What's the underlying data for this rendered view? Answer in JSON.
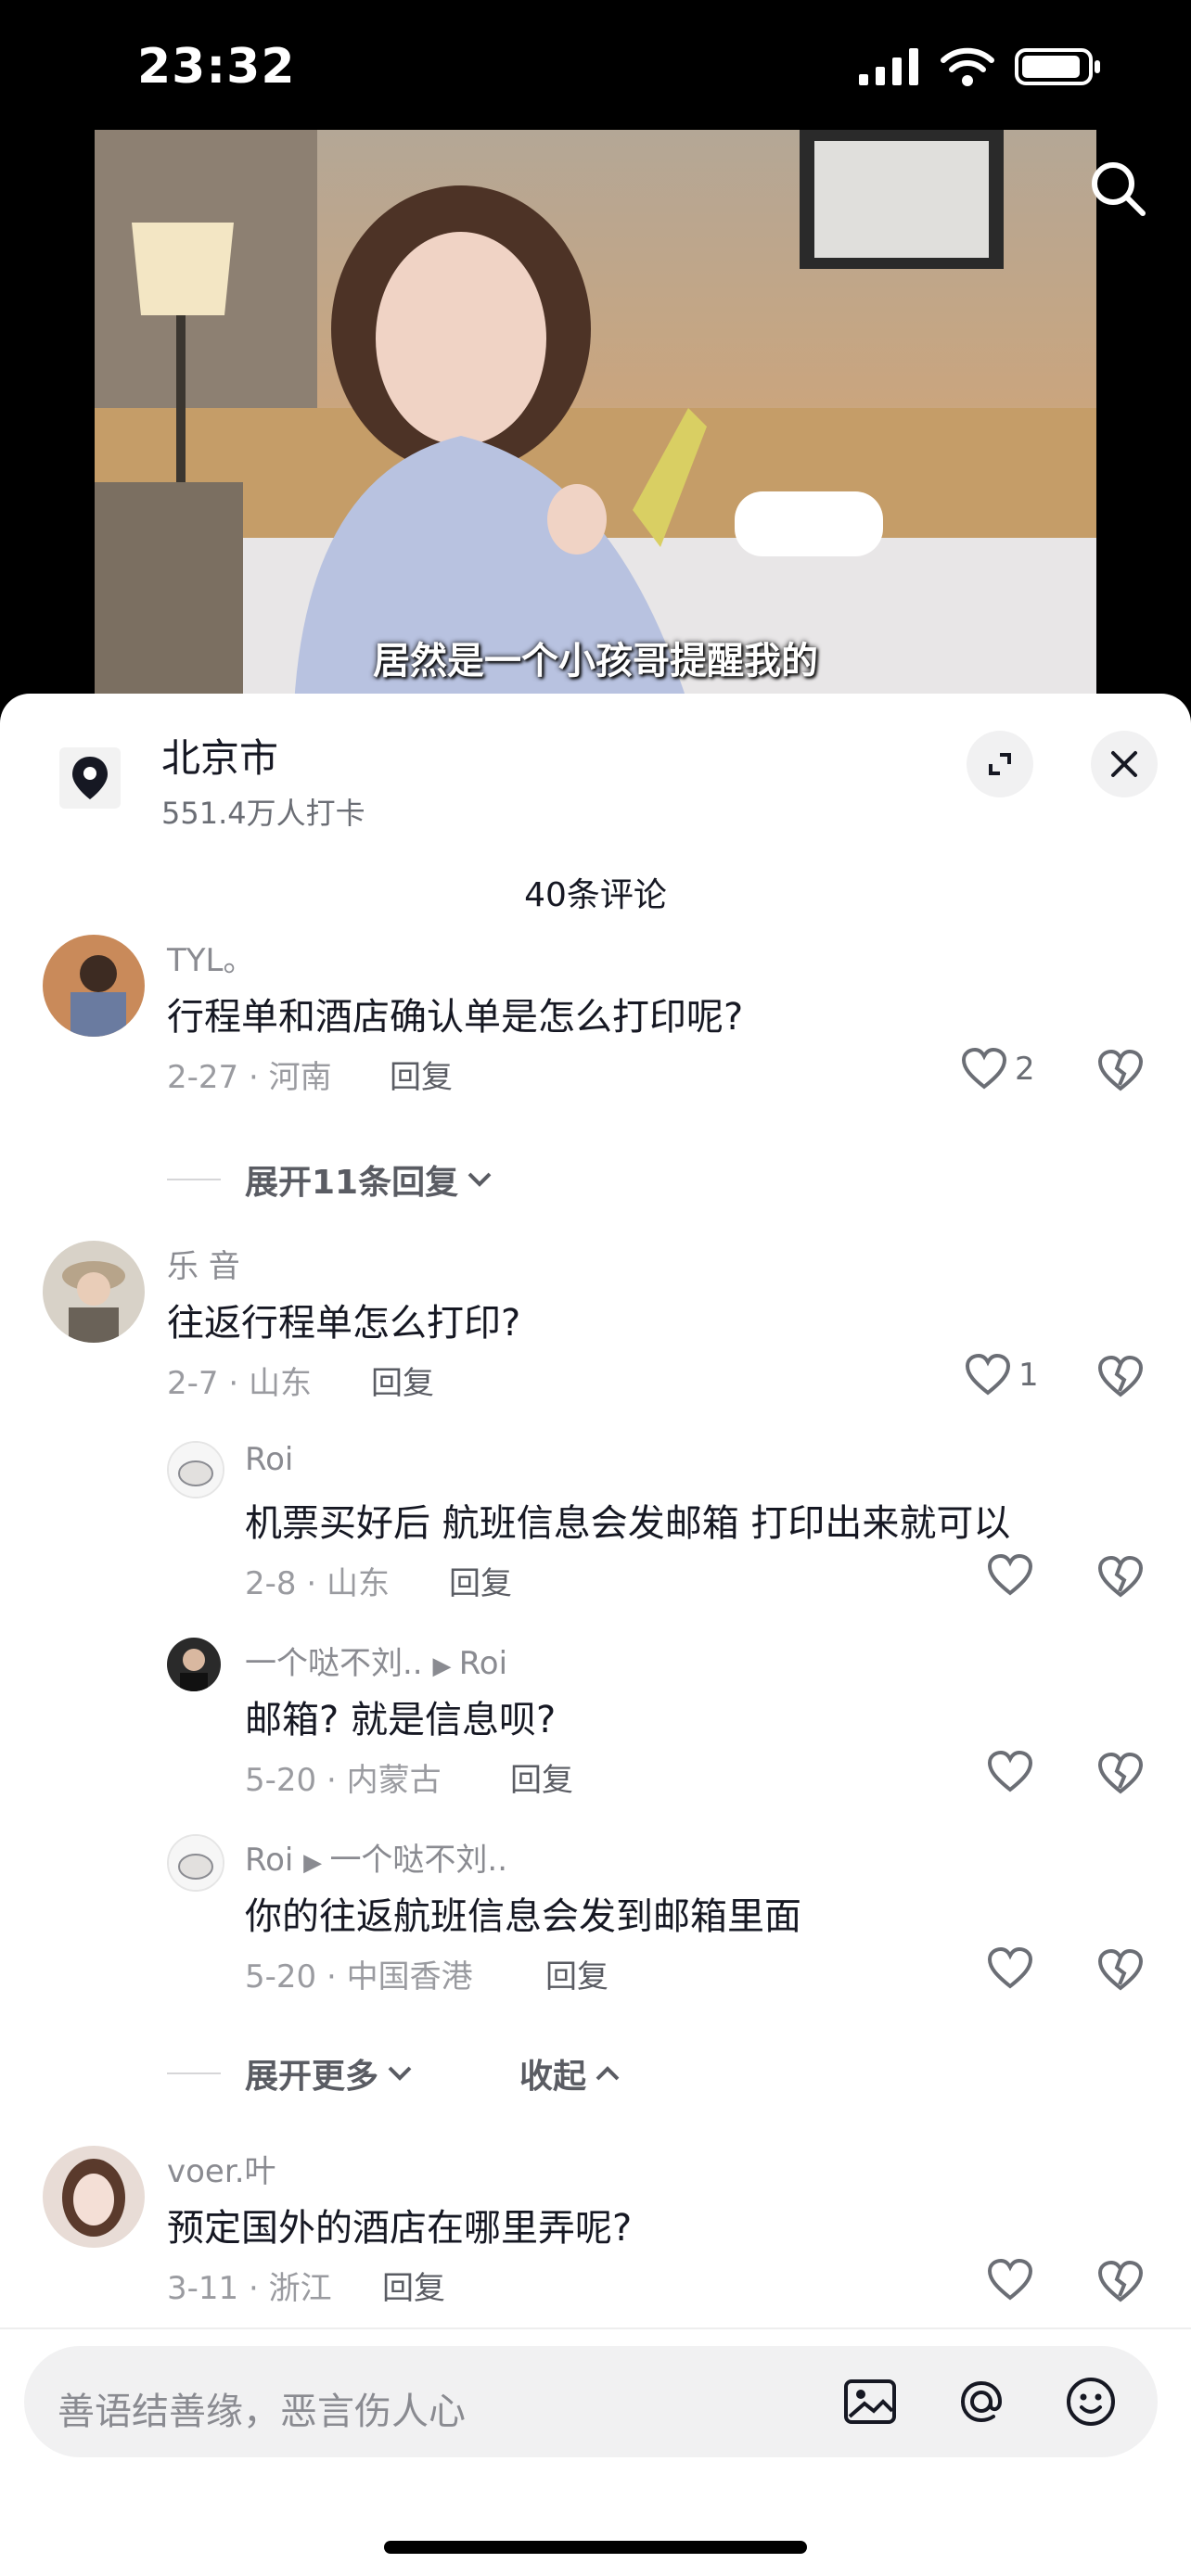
{
  "status": {
    "time": "23:32"
  },
  "video": {
    "subtitle": "居然是一个小孩哥提醒我的"
  },
  "location": {
    "title": "北京市",
    "checkins": "551.4万人打卡"
  },
  "comments_count": "40条评论",
  "comments": [
    {
      "user": "TYL。",
      "text": "行程单和酒店确认单是怎么打印呢?",
      "meta": "2-27 · 河南",
      "reply": "回复",
      "likes": "2"
    },
    {
      "user": "乐 音",
      "text": "往返行程单怎么打印?",
      "meta": "2-7 · 山东",
      "reply": "回复",
      "likes": "1"
    },
    {
      "user": "Roi",
      "text": "机票买好后 航班信息会发邮箱 打印出来就可以",
      "meta": "2-8 · 山东",
      "reply": "回复"
    },
    {
      "user": "一个哒不刘..",
      "to": "Roi",
      "text": "邮箱? 就是信息呗?",
      "meta": "5-20 · 内蒙古",
      "reply": "回复"
    },
    {
      "user": "Roi",
      "to": "一个哒不刘..",
      "text": "你的往返航班信息会发到邮箱里面",
      "meta": "5-20 · 中国香港",
      "reply": "回复"
    },
    {
      "user": "voer.叶",
      "text": "预定国外的酒店在哪里弄呢?",
      "meta": "3-11 · 浙江",
      "reply": "回复"
    }
  ],
  "expand_replies": "展开11条回复",
  "expand_more": "展开更多",
  "collapse": "收起",
  "input": {
    "placeholder": "善语结善缘，恶言伤人心"
  }
}
